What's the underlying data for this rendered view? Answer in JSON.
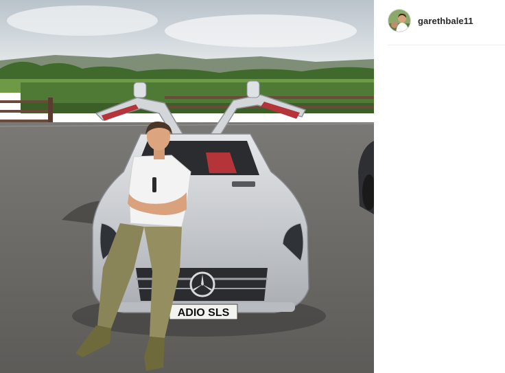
{
  "post": {
    "username": "garethbale11",
    "license_plate": "ADIO SLS",
    "photo_icon": "photo-image"
  },
  "colors": {
    "sky": "#cfd6dc",
    "hedge": "#4f7a35",
    "asphalt": "#6e6c69",
    "car": "#c9ccd0",
    "interior_red": "#b5343a"
  }
}
